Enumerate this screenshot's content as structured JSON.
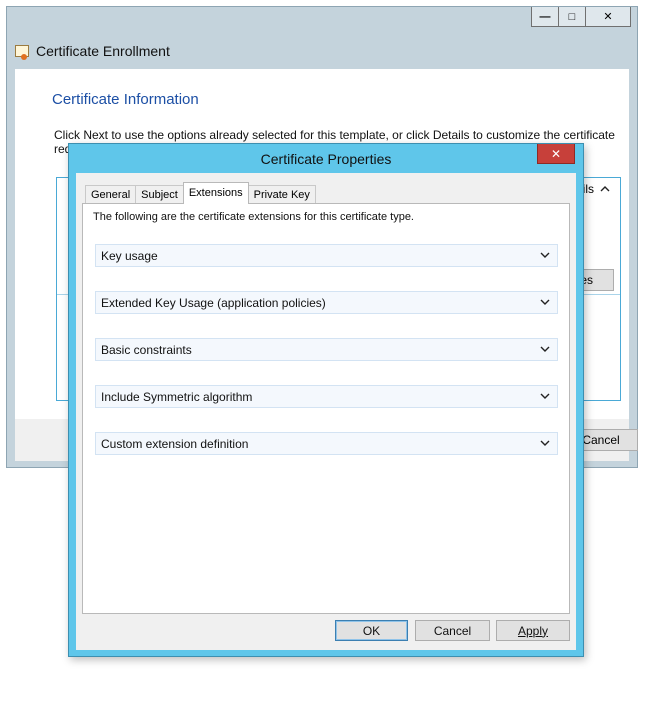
{
  "wizard": {
    "title": "Certificate Enrollment",
    "heading": "Certificate Information",
    "description": "Click Next to use the options already selected for this template, or click Details to customize the certificate request",
    "details_label": "ils",
    "properties_label": "es",
    "cancel_label": "Cancel",
    "window_controls": [
      "minimize-icon",
      "maximize-icon",
      "close-icon"
    ]
  },
  "dialog": {
    "title": "Certificate Properties",
    "close_glyph": "✕",
    "tabs": [
      {
        "label": "General",
        "active": false
      },
      {
        "label": "Subject",
        "active": false
      },
      {
        "label": "Extensions",
        "active": true
      },
      {
        "label": "Private Key",
        "active": false
      }
    ],
    "panel_description": "The following are the certificate extensions for this certificate type.",
    "extensions": [
      {
        "label": "Key usage"
      },
      {
        "label": "Extended Key Usage (application policies)"
      },
      {
        "label": "Basic constraints"
      },
      {
        "label": "Include Symmetric algorithm"
      },
      {
        "label": "Custom extension definition"
      }
    ],
    "buttons": {
      "ok": "OK",
      "cancel": "Cancel",
      "apply": "Apply"
    }
  },
  "colors": {
    "dialog_frame": "#5fc6ea",
    "close_button": "#c7403a",
    "heading_blue": "#1c4fa5"
  }
}
